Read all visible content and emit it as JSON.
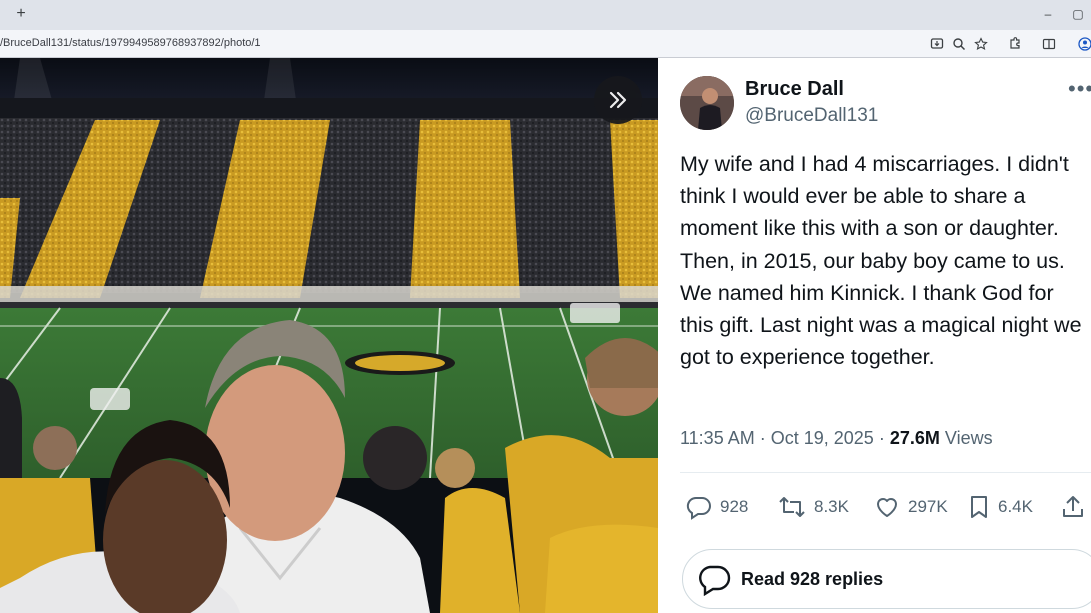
{
  "browser": {
    "new_tab_symbol": "+",
    "url": "/BruceDall131/status/1979949589768937892/photo/1",
    "toolbar_icons": [
      "install-icon",
      "zoom-icon",
      "star-icon",
      "extensions-icon",
      "split-screen-icon",
      "profile-icon"
    ],
    "window_controls": {
      "minimize": "–",
      "restore": "▢"
    }
  },
  "photo": {
    "description_icon": "expand-chevrons-icon"
  },
  "tweet": {
    "display_name": "Bruce Dall",
    "handle": "@BruceDall131",
    "more_symbol": "•••",
    "text": "My wife and I had 4 miscarriages. I didn't think I would ever be able to share a moment like this with a son or daughter. Then, in 2015, our baby boy came to us. We named him Kinnick. I thank God for this gift. Last night was a magical night we got to experience together.",
    "time": "11:35 AM",
    "separator": "·",
    "date": "Oct 19, 2025",
    "views_count": "27.6M",
    "views_label": "Views",
    "actions": {
      "replies": "928",
      "reposts": "8.3K",
      "likes": "297K",
      "bookmarks": "6.4K"
    },
    "read_replies_label": "Read 928 replies"
  },
  "colors": {
    "gold": "#e0b12a",
    "field_green": "#3f7a3a",
    "text_primary": "#0f1419",
    "text_secondary": "#536471"
  }
}
